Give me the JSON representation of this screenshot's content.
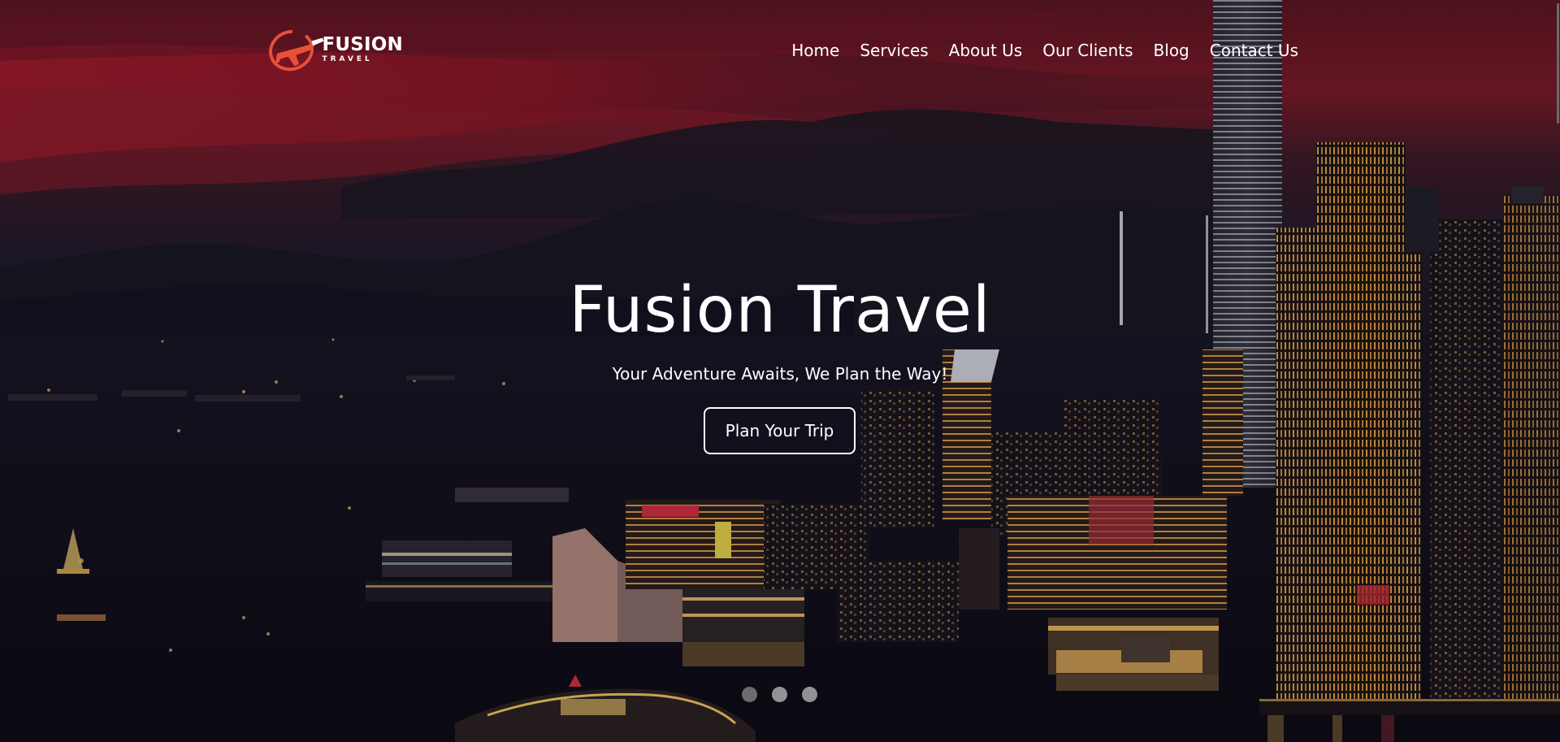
{
  "brand": {
    "name": "FUSION",
    "tagline": "TRAVEL",
    "logo_icon": "airplane-orbit-icon",
    "accent_color": "#e8503a"
  },
  "nav": {
    "items": [
      {
        "label": "Home"
      },
      {
        "label": "Services"
      },
      {
        "label": "About Us"
      },
      {
        "label": "Our Clients"
      },
      {
        "label": "Blog"
      },
      {
        "label": "Contact Us"
      }
    ]
  },
  "hero": {
    "title": "Fusion Travel",
    "subtitle": "Your Adventure Awaits, We Plan the Way!",
    "cta_label": "Plan Your Trip",
    "background": "night city skyline harbor with red sunset sky",
    "slides": {
      "count": 3,
      "active_index": 0
    }
  }
}
